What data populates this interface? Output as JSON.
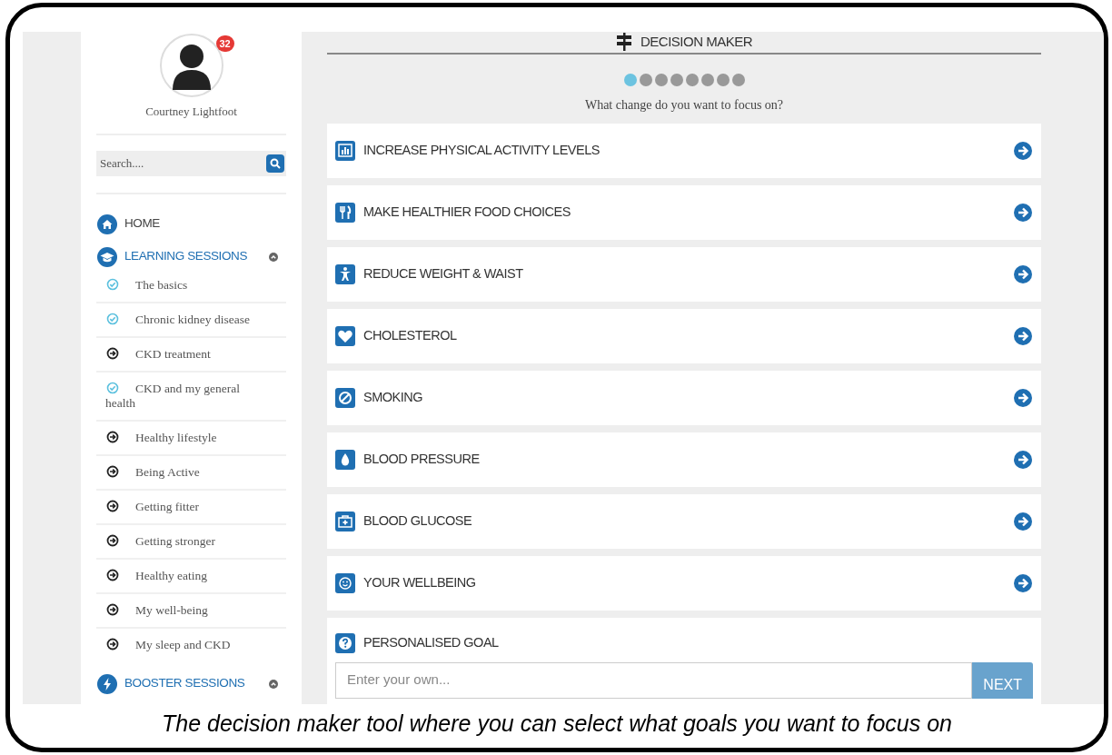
{
  "profile": {
    "name": "Courtney Lightfoot",
    "badge": "32"
  },
  "search": {
    "placeholder": "Search...."
  },
  "nav": [
    {
      "label": "HOME",
      "kind": "home",
      "selected": false
    },
    {
      "label": "LEARNING SESSIONS",
      "kind": "learning",
      "selected": true,
      "expanded": true,
      "children": [
        {
          "label": "The basics",
          "completed": true
        },
        {
          "label": "Chronic kidney disease",
          "completed": true
        },
        {
          "label": "CKD treatment",
          "completed": false
        },
        {
          "label": "CKD and my general health",
          "completed": true
        },
        {
          "label": "Healthy lifestyle",
          "completed": false
        },
        {
          "label": "Being Active",
          "completed": false
        },
        {
          "label": "Getting fitter",
          "completed": false
        },
        {
          "label": "Getting stronger",
          "completed": false
        },
        {
          "label": "Healthy eating",
          "completed": false
        },
        {
          "label": "My well-being",
          "completed": false
        },
        {
          "label": "My sleep and CKD",
          "completed": false
        }
      ]
    },
    {
      "label": "BOOSTER SESSIONS",
      "kind": "booster",
      "selected": true,
      "expanded": true
    }
  ],
  "header": {
    "title": "DECISION MAKER"
  },
  "steps": [
    {
      "selected": true
    },
    {
      "selected": false
    },
    {
      "selected": false
    },
    {
      "selected": false
    },
    {
      "selected": false
    },
    {
      "selected": false
    },
    {
      "selected": false
    },
    {
      "selected": false
    }
  ],
  "question": "What change do you want to focus on?",
  "options": [
    {
      "label": "INCREASE PHYSICAL ACTIVITY LEVELS"
    },
    {
      "label": "MAKE HEALTHIER FOOD CHOICES"
    },
    {
      "label": "REDUCE WEIGHT & WAIST"
    },
    {
      "label": "CHOLESTEROL"
    },
    {
      "label": "SMOKING"
    },
    {
      "label": "BLOOD PRESSURE"
    },
    {
      "label": "BLOOD GLUCOSE"
    },
    {
      "label": "YOUR WELLBEING"
    }
  ],
  "custom_goal": {
    "label": "PERSONALISED GOAL",
    "placeholder": "Enter your own...",
    "button": "NEXT"
  },
  "caption": "The decision maker tool where you can select what goals you want to focus on"
}
